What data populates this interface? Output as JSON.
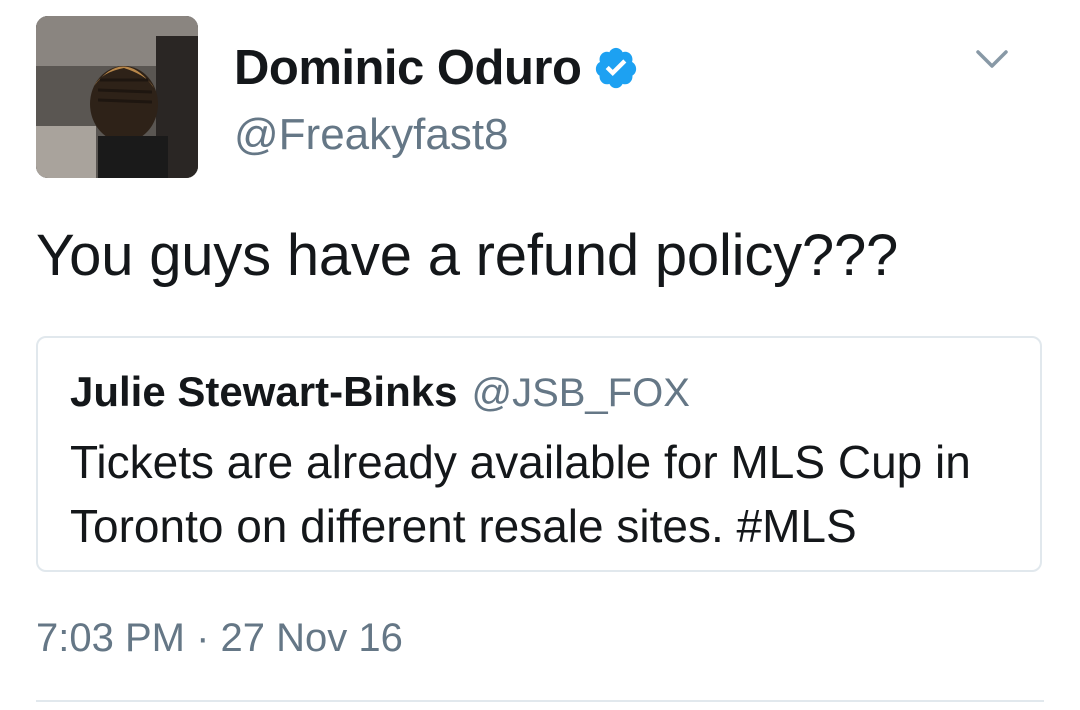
{
  "tweet": {
    "author": {
      "display_name": "Dominic Oduro",
      "handle": "@Freakyfast8",
      "verified": true
    },
    "text": "You guys have a refund policy???",
    "quoted_tweet": {
      "display_name": "Julie Stewart-Binks",
      "handle": "@JSB_FOX",
      "text": "Tickets are already available for MLS Cup in Toronto on different resale sites. #MLS"
    },
    "timestamp": "7:03 PM · 27 Nov 16"
  },
  "icons": {
    "verified": "verified-badge-icon",
    "caret": "chevron-down-icon"
  },
  "colors": {
    "verified_blue": "#1da1f2",
    "secondary_text": "#657786",
    "border": "#e1e8ed"
  }
}
